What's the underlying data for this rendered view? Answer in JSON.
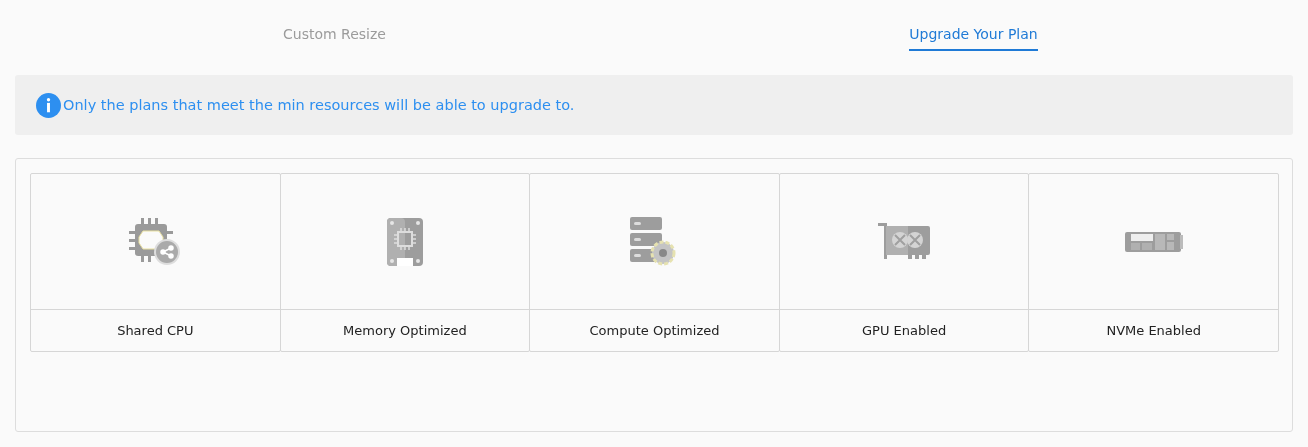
{
  "tabs": [
    {
      "label": "Custom Resize",
      "selected": false
    },
    {
      "label": "Upgrade Your Plan",
      "selected": true
    }
  ],
  "notice": {
    "text": "Only the plans that meet the min resources will be able to upgrade to."
  },
  "plans": [
    {
      "kind": "shared",
      "label": "Shared CPU"
    },
    {
      "kind": "memory",
      "label": "Memory Optimized"
    },
    {
      "kind": "compute",
      "label": "Compute Optimized"
    },
    {
      "kind": "gpu",
      "label": "GPU Enabled"
    },
    {
      "kind": "nvme",
      "label": "NVMe Enabled"
    }
  ]
}
